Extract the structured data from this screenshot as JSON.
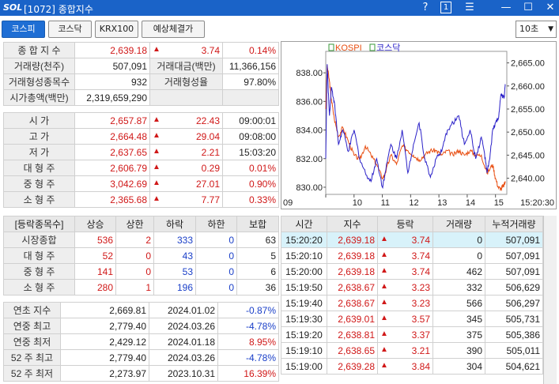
{
  "titlebar": {
    "logo": "SOL",
    "title": "[1072] 종합지수",
    "help": "?",
    "page": "1",
    "menu": "☰",
    "minimize": "—",
    "maximize": "☐",
    "close": "✕"
  },
  "tabs": [
    "코스피",
    "코스닥",
    "KRX100",
    "예상체결가"
  ],
  "interval": {
    "value": "10초",
    "arrow": "▼"
  },
  "summary": {
    "composite_label": "종 합 지 수",
    "composite_value": "2,639.18",
    "composite_arrow": "▲",
    "composite_change": "3.74",
    "composite_pct": "0.14%",
    "volume_label": "거래량(천주)",
    "volume_value": "507,091",
    "amount_label": "거래대금(백만)",
    "amount_value": "11,366,156",
    "formed_stocks_label": "거래형성종목수",
    "formed_stocks_value": "932",
    "formed_rate_label": "거래형성율",
    "formed_rate_value": "97.80%",
    "market_cap_label": "시가총액(백만)",
    "market_cap_value": "2,319,659,290"
  },
  "prices": [
    {
      "label": "시        가",
      "value": "2,657.87",
      "arrow": "▲",
      "change": "22.43",
      "extra": "09:00:01"
    },
    {
      "label": "고        가",
      "value": "2,664.48",
      "arrow": "▲",
      "change": "29.04",
      "extra": "09:08:00"
    },
    {
      "label": "저        가",
      "value": "2,637.65",
      "arrow": "▲",
      "change": "2.21",
      "extra": "15:03:20"
    },
    {
      "label": "대 형 주",
      "value": "2,606.79",
      "arrow": "▲",
      "change": "0.29",
      "extra": "0.01%"
    },
    {
      "label": "중 형 주",
      "value": "3,042.69",
      "arrow": "▲",
      "change": "27.01",
      "extra": "0.90%"
    },
    {
      "label": "소 형 주",
      "value": "2,365.68",
      "arrow": "▲",
      "change": "7.77",
      "extra": "0.33%"
    }
  ],
  "breadth": {
    "headers": [
      "[등락종목수]",
      "상승",
      "상한",
      "하락",
      "하한",
      "보합"
    ],
    "rows": [
      {
        "label": "시장종합",
        "up": "536",
        "upper": "2",
        "down": "333",
        "lower": "0",
        "flat": "63"
      },
      {
        "label": "대 형 주",
        "up": "52",
        "upper": "0",
        "down": "43",
        "lower": "0",
        "flat": "5"
      },
      {
        "label": "중 형 주",
        "up": "141",
        "upper": "0",
        "down": "53",
        "lower": "0",
        "flat": "6"
      },
      {
        "label": "소 형 주",
        "up": "280",
        "upper": "1",
        "down": "196",
        "lower": "0",
        "flat": "36"
      }
    ]
  },
  "yearly": [
    {
      "label": "연초  지수",
      "value": "2,669.81",
      "date": "2024.01.02",
      "pct": "-0.87%",
      "color": "blue"
    },
    {
      "label": "연중  최고",
      "value": "2,779.40",
      "date": "2024.03.26",
      "pct": "-4.78%",
      "color": "blue"
    },
    {
      "label": "연중  최저",
      "value": "2,429.12",
      "date": "2024.01.18",
      "pct": "8.95%",
      "color": "red"
    },
    {
      "label": "52 주 최고",
      "value": "2,779.40",
      "date": "2024.03.26",
      "pct": "-4.78%",
      "color": "blue"
    },
    {
      "label": "52 주 최저",
      "value": "2,273.97",
      "date": "2023.10.31",
      "pct": "16.39%",
      "color": "red"
    }
  ],
  "ticks": {
    "headers": [
      "시간",
      "지수",
      "등락",
      "거래량",
      "누적거래량"
    ],
    "rows": [
      {
        "time": "15:20:20",
        "index": "2,639.18",
        "arrow": "▲",
        "change": "3.74",
        "vol": "0",
        "cum": "507,091"
      },
      {
        "time": "15:20:10",
        "index": "2,639.18",
        "arrow": "▲",
        "change": "3.74",
        "vol": "0",
        "cum": "507,091"
      },
      {
        "time": "15:20:00",
        "index": "2,639.18",
        "arrow": "▲",
        "change": "3.74",
        "vol": "462",
        "cum": "507,091"
      },
      {
        "time": "15:19:50",
        "index": "2,638.67",
        "arrow": "▲",
        "change": "3.23",
        "vol": "332",
        "cum": "506,629"
      },
      {
        "time": "15:19:40",
        "index": "2,638.67",
        "arrow": "▲",
        "change": "3.23",
        "vol": "566",
        "cum": "506,297"
      },
      {
        "time": "15:19:30",
        "index": "2,639.01",
        "arrow": "▲",
        "change": "3.57",
        "vol": "345",
        "cum": "505,731"
      },
      {
        "time": "15:19:20",
        "index": "2,638.81",
        "arrow": "▲",
        "change": "3.37",
        "vol": "375",
        "cum": "505,386"
      },
      {
        "time": "15:19:10",
        "index": "2,638.65",
        "arrow": "▲",
        "change": "3.21",
        "vol": "390",
        "cum": "505,011"
      },
      {
        "time": "15:19:00",
        "index": "2,639.28",
        "arrow": "▲",
        "change": "3.84",
        "vol": "304",
        "cum": "504,621"
      }
    ]
  },
  "chart_data": {
    "type": "line",
    "legend": [
      "KOSPI",
      "코스닥"
    ],
    "colors": {
      "KOSPI": "#e84d10",
      "코스닥": "#2a20c8"
    },
    "left_axis_ticks": [
      "838.00",
      "836.00",
      "834.00",
      "832.00",
      "830.00"
    ],
    "right_axis_ticks": [
      "2,665.00",
      "2,660.00",
      "2,655.00",
      "2,650.00",
      "2,645.00",
      "2,640.00"
    ],
    "x_ticks": [
      "09",
      "10",
      "11",
      "12",
      "13",
      "14",
      "15"
    ],
    "last_time": "15:20:30",
    "left_ylim": [
      829.5,
      839.5
    ],
    "right_ylim": [
      2636.5,
      2667.5
    ],
    "series": [
      {
        "name": "KOSPI",
        "axis": "right",
        "x": [
          9.0,
          9.05,
          9.13,
          9.2,
          9.3,
          9.45,
          9.6,
          9.8,
          10.0,
          10.2,
          10.4,
          10.6,
          10.8,
          11.0,
          11.1,
          11.3,
          11.5,
          11.7,
          11.9,
          12.1,
          12.3,
          12.5,
          12.7,
          12.9,
          13.1,
          13.3,
          13.5,
          13.7,
          13.9,
          14.1,
          14.3,
          14.5,
          14.7,
          14.9,
          15.0,
          15.1,
          15.2,
          15.3,
          15.35
        ],
        "values": [
          2655,
          2664.5,
          2661,
          2657,
          2653,
          2649,
          2651,
          2648,
          2645,
          2644,
          2647,
          2645,
          2643,
          2640,
          2641,
          2645,
          2643,
          2647,
          2646,
          2645,
          2644,
          2645,
          2646,
          2646,
          2645,
          2646,
          2645,
          2646,
          2645,
          2646,
          2645,
          2645,
          2641,
          2643,
          2640,
          2638,
          2637.7,
          2638.5,
          2639.2
        ]
      },
      {
        "name": "코스닥",
        "axis": "left",
        "x": [
          9.0,
          9.05,
          9.13,
          9.2,
          9.3,
          9.45,
          9.6,
          9.8,
          10.0,
          10.2,
          10.4,
          10.6,
          10.8,
          11.0,
          11.1,
          11.3,
          11.5,
          11.7,
          11.9,
          12.1,
          12.3,
          12.5,
          12.7,
          12.9,
          13.1,
          13.3,
          13.5,
          13.7,
          13.9,
          14.1,
          14.3,
          14.5,
          14.6,
          14.7,
          14.8,
          14.9,
          15.0,
          15.1,
          15.2,
          15.3,
          15.35
        ],
        "values": [
          832,
          838.6,
          835,
          837,
          836,
          833,
          834,
          832.5,
          834,
          832,
          831,
          830.4,
          832,
          830,
          831,
          833,
          832,
          834,
          831,
          833,
          834.5,
          832,
          830.7,
          832,
          832.5,
          834,
          834.5,
          835,
          833,
          834,
          832,
          833.5,
          832.5,
          831,
          832,
          834,
          834.5,
          834.8,
          836.5,
          836.2,
          837.2
        ]
      }
    ]
  }
}
